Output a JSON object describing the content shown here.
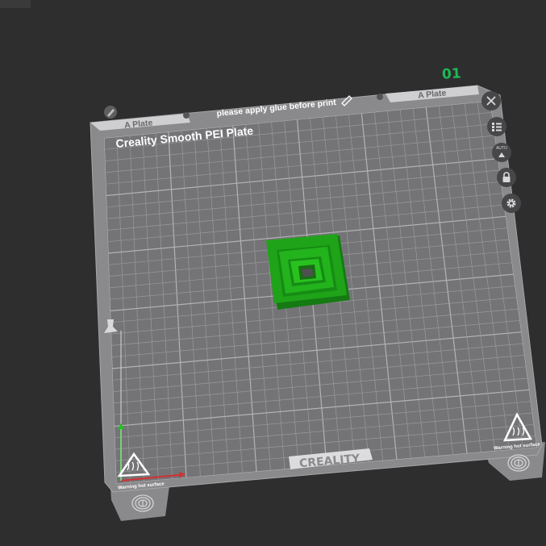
{
  "plate": {
    "index": "01",
    "tab_left_label": "A Plate",
    "tab_right_label": "A Plate",
    "note": "please apply glue before print",
    "bed_name": "Creality Smooth PEI Plate",
    "brand": "CREALITY",
    "warning_left": "Warning hot surface",
    "warning_right": "Warning hot surface"
  },
  "controls": {
    "close": "close-icon",
    "list": "list-icon",
    "auto_arrange": "auto-arrange-icon",
    "auto_label": "AUTO",
    "lock": "lock-icon",
    "settings": "gear-icon"
  },
  "colors": {
    "background": "#2e2e2f",
    "plate": "#8a8a8d",
    "bed": "#747477",
    "grid": "#a4a4a7",
    "model": "#1fa319",
    "accent": "#1db954"
  }
}
